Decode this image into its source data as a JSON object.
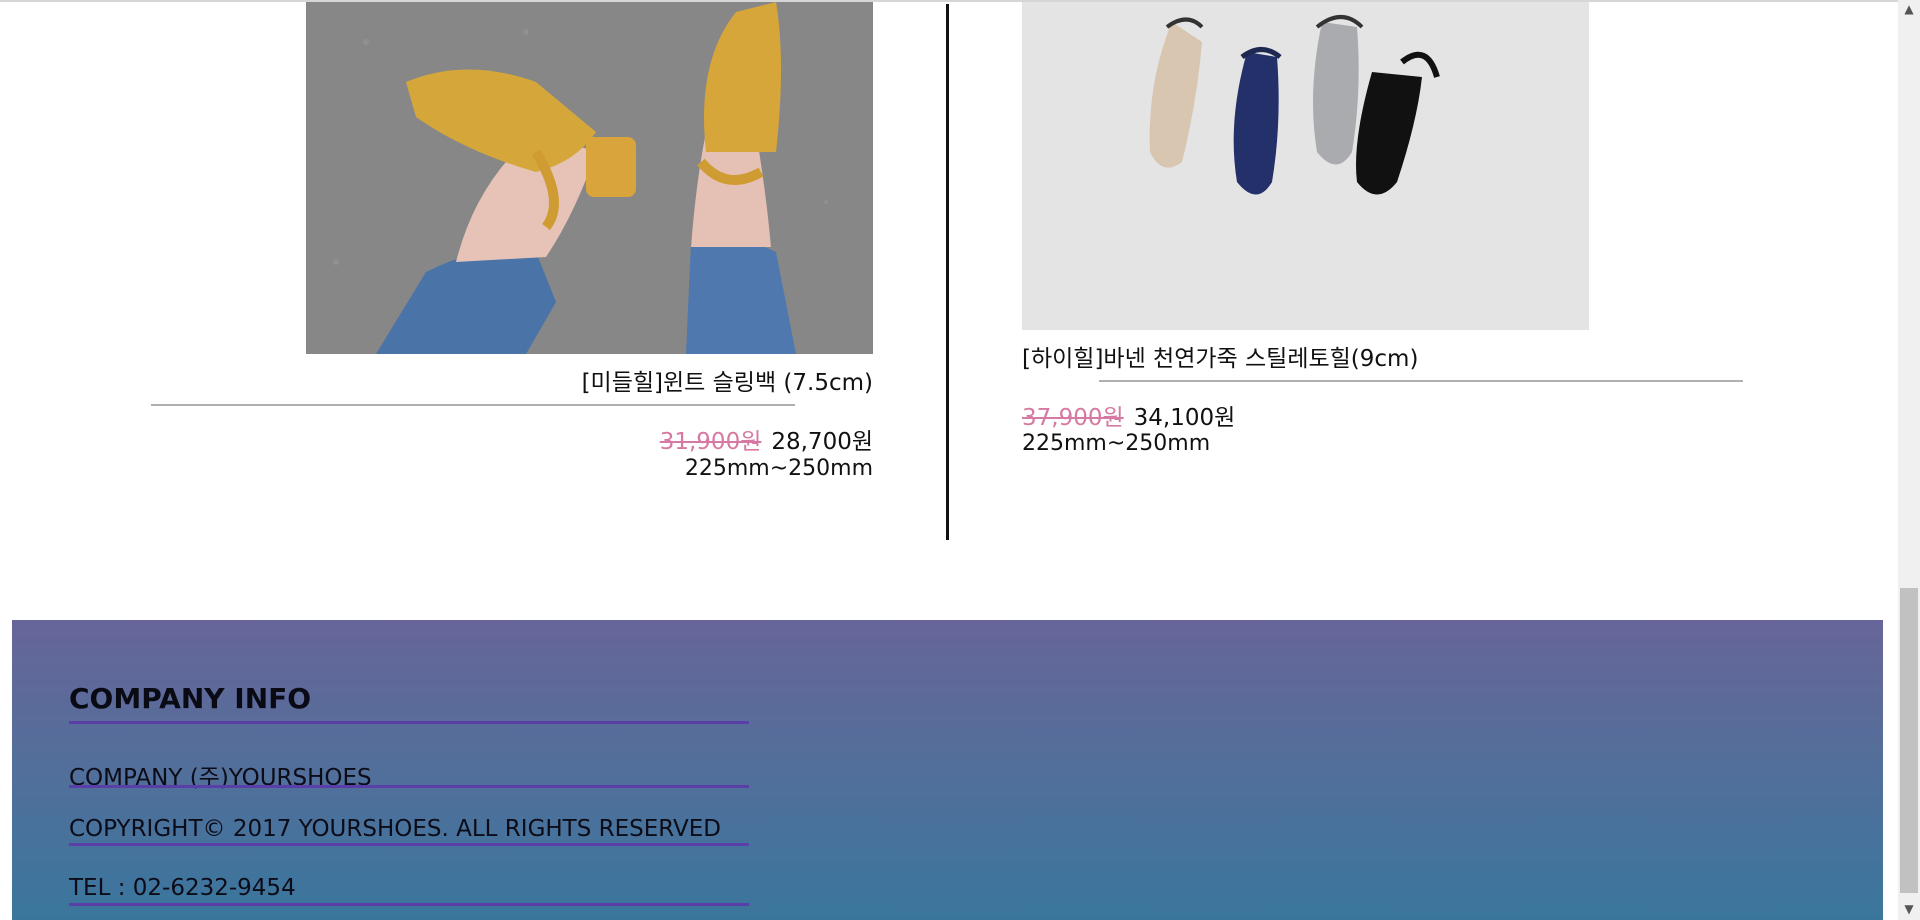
{
  "products": [
    {
      "name": "[미들힐]윈트 슬링백 (7.5cm)",
      "old_price": "31,900원",
      "price": "28,700원",
      "size": "225mm~250mm",
      "image_desc": "yellow-slingback-heels"
    },
    {
      "name": "[하이힐]바넨 천연가죽 스틸레토힐(9cm)",
      "old_price": "37,900원",
      "price": "34,100원",
      "size": "225mm~250mm",
      "image_desc": "four-stiletto-heels"
    }
  ],
  "footer": {
    "title": "COMPANY INFO",
    "company": "COMPANY (주)YOURSHOES",
    "copyright": "COPYRIGHT© 2017 YOURSHOES. ALL RIGHTS RESERVED",
    "tel": "TEL : 02-6232-9454"
  },
  "colors": {
    "old_price": "#d67aa3",
    "footer_top": "#67659a",
    "footer_bottom": "#3a769c",
    "footer_rule": "#5a3fa8"
  }
}
